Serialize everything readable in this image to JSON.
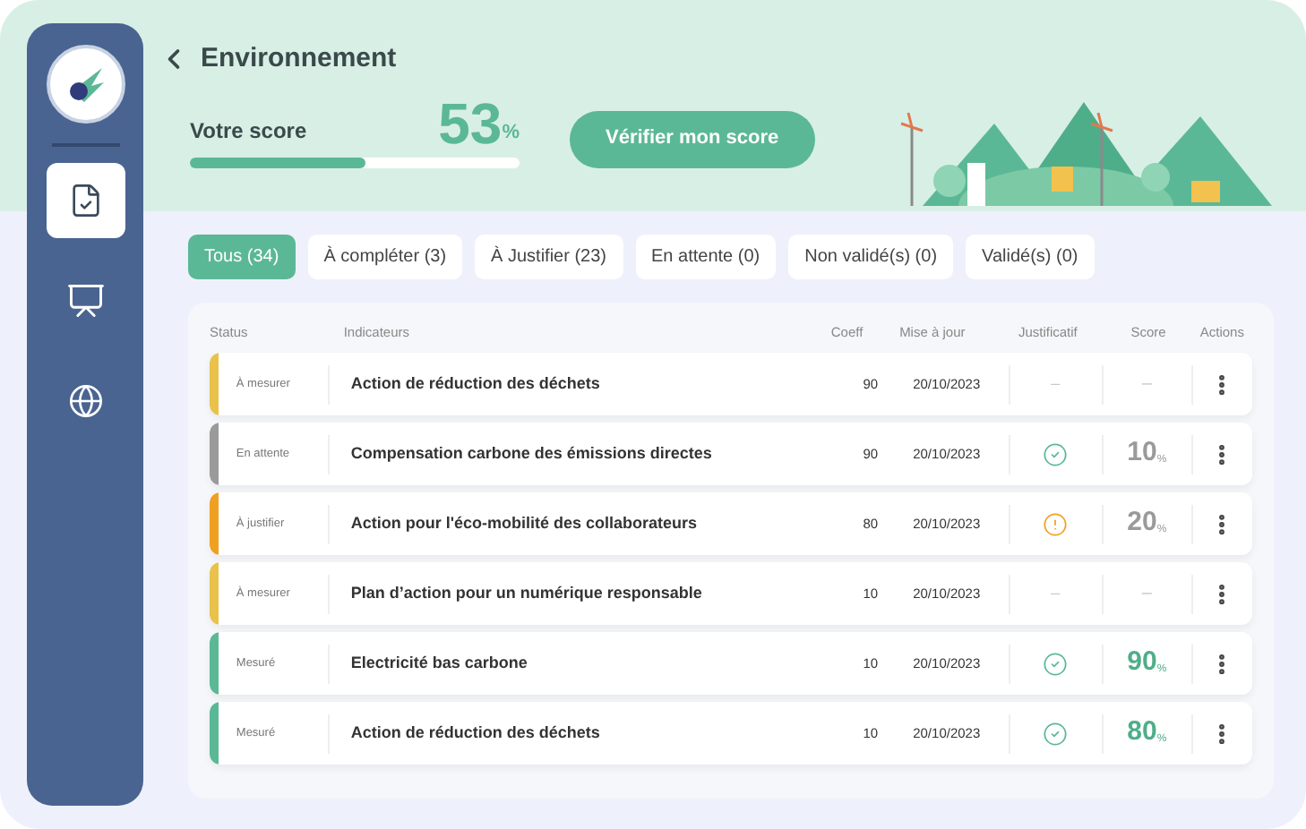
{
  "header": {
    "title": "Environnement",
    "score_label": "Votre score",
    "score_value": "53",
    "score_unit": "%",
    "level": 0.53,
    "button": "Vérifier mon score"
  },
  "sidebar": {
    "items": [
      {
        "kind": "document",
        "selected": true
      },
      {
        "kind": "chart",
        "selected": false
      },
      {
        "kind": "globe",
        "selected": false
      }
    ]
  },
  "tabs": [
    {
      "label": "Tous (34)",
      "selected": true
    },
    {
      "label": "À compléter (3)",
      "selected": false
    },
    {
      "label": "À Justifier (23)",
      "selected": false
    },
    {
      "label": "En attente (0)",
      "selected": false
    },
    {
      "label": "Non validé(s) (0)",
      "selected": false
    },
    {
      "label": "Validé(s) (0)",
      "selected": false
    }
  ],
  "table": {
    "columns": [
      "Status",
      "Indicateurs",
      "Coeff",
      "Mise à jour",
      "Justificatif",
      "Score",
      "Actions"
    ],
    "rows": [
      {
        "color": "#e8c24a",
        "status": "À mesurer",
        "indicator": "Action de réduction des déchets",
        "coeff": "90",
        "date": "20/10/2023",
        "justif": {
          "kind": "none",
          "text": "–"
        },
        "score": {
          "kind": "none",
          "text": "–"
        }
      },
      {
        "color": "#9a9a9a",
        "status": "En attente",
        "indicator": "Compensation carbone des émissions directes",
        "coeff": "90",
        "date": "20/10/2023",
        "justif": {
          "kind": "check"
        },
        "score": {
          "kind": "muted",
          "text": "10",
          "unit": "%"
        }
      },
      {
        "color": "#f0a020",
        "status": "À justifier",
        "indicator": "Action pour l'éco-mobilité des collaborateurs",
        "coeff": "80",
        "date": "20/10/2023",
        "justif": {
          "kind": "warning"
        },
        "score": {
          "kind": "muted",
          "text": "20",
          "unit": "%"
        }
      },
      {
        "color": "#e8c24a",
        "status": "À mesurer",
        "indicator": "Plan d’action pour un numérique responsable",
        "coeff": "10",
        "date": "20/10/2023",
        "justif": {
          "kind": "none",
          "text": "–"
        },
        "score": {
          "kind": "none",
          "text": "–"
        }
      },
      {
        "color": "#5bb896",
        "status": "Mesuré",
        "indicator": "Electricité bas carbone",
        "coeff": "10",
        "date": "20/10/2023",
        "justif": {
          "kind": "check"
        },
        "score": {
          "kind": "good",
          "text": "90",
          "unit": "%"
        }
      },
      {
        "color": "#5bb896",
        "status": "Mesuré",
        "indicator": "Action de réduction des déchets",
        "coeff": "10",
        "date": "20/10/2023",
        "justif": {
          "kind": "check"
        },
        "score": {
          "kind": "good",
          "text": "80",
          "unit": "%"
        }
      }
    ]
  }
}
